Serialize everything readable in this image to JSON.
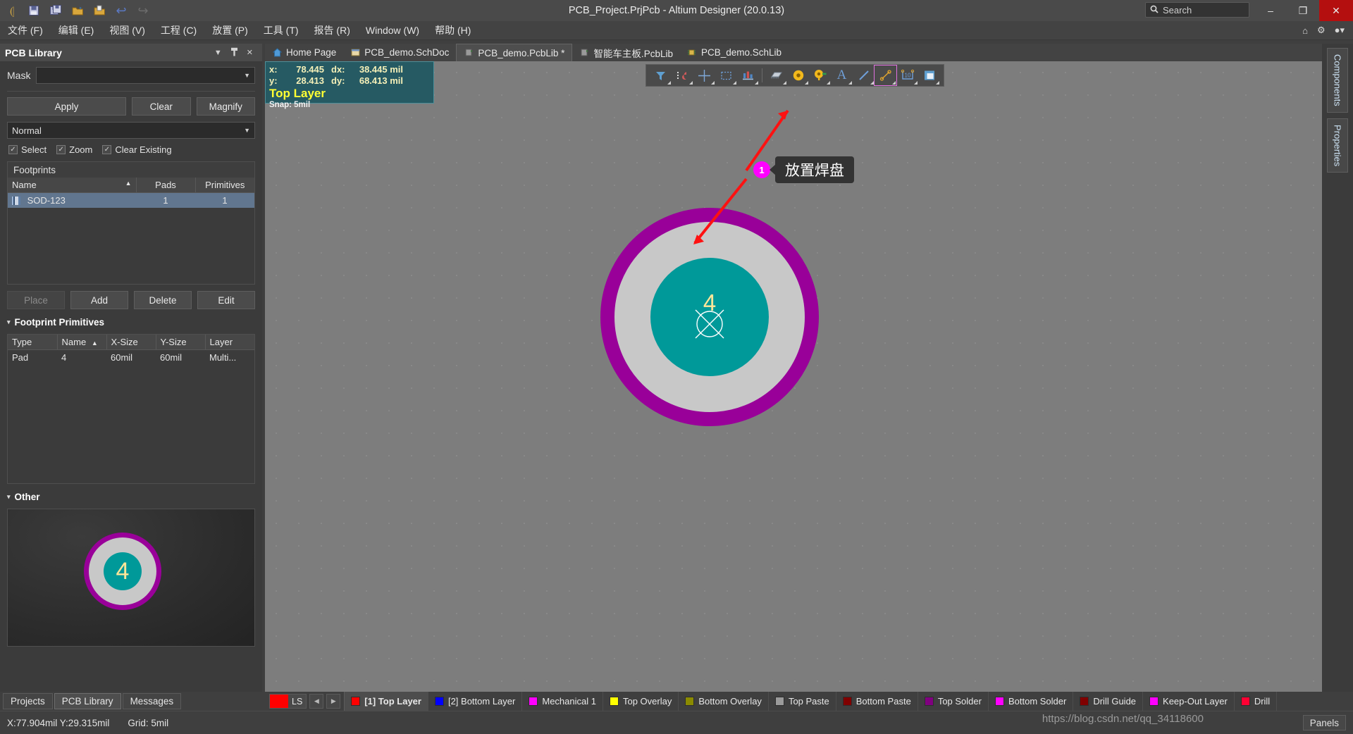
{
  "titlebar": {
    "title": "PCB_Project.PrjPcb - Altium Designer (20.0.13)",
    "quick_access": [
      {
        "name": "altium-logo-icon",
        "glyph": "⚇"
      },
      {
        "name": "save-icon",
        "glyph": "💾"
      },
      {
        "name": "save-all-icon",
        "glyph": "🖫"
      },
      {
        "name": "open-folder-icon",
        "glyph": "📂"
      },
      {
        "name": "open-project-icon",
        "glyph": "🗁"
      },
      {
        "name": "undo-icon",
        "glyph": "↶"
      },
      {
        "name": "redo-icon",
        "glyph": "↷"
      }
    ],
    "search_placeholder": "Search",
    "search_value": "",
    "minimize": "–",
    "maximize": "❐",
    "close": "✕"
  },
  "menubar": {
    "items": [
      "文件 (F)",
      "编辑 (E)",
      "视图 (V)",
      "工程 (C)",
      "放置 (P)",
      "工具 (T)",
      "报告 (R)",
      "Window (W)",
      "帮助 (H)"
    ],
    "right_icons": [
      {
        "name": "home-icon",
        "glyph": "⌂"
      },
      {
        "name": "gear-icon",
        "glyph": "⚙"
      },
      {
        "name": "user-icon",
        "glyph": "●▾"
      }
    ]
  },
  "pcb_library_panel": {
    "title": "PCB Library",
    "header_buttons": [
      {
        "name": "panel-dropdown-icon",
        "glyph": "▼"
      },
      {
        "name": "pin-icon",
        "glyph": "⬇"
      },
      {
        "name": "close-icon",
        "glyph": "✕"
      }
    ],
    "mask_label": "Mask",
    "mask_value": "",
    "buttons": {
      "apply": "Apply",
      "clear": "Clear",
      "magnify": "Magnify"
    },
    "mode_value": "Normal",
    "checkboxes": [
      {
        "label": "Select",
        "checked": true
      },
      {
        "label": "Zoom",
        "checked": true
      },
      {
        "label": "Clear Existing",
        "checked": true
      }
    ],
    "footprints": {
      "caption": "Footprints",
      "columns": [
        "Name",
        "Pads",
        "Primitives"
      ],
      "sort_column": "Name",
      "rows": [
        {
          "name": "SOD-123",
          "pads": "1",
          "primitives": "1",
          "selected": true
        }
      ]
    },
    "footprint_buttons": {
      "place": "Place",
      "place_disabled": true,
      "add": "Add",
      "delete": "Delete",
      "edit": "Edit"
    },
    "primitives": {
      "section_title": "Footprint Primitives",
      "columns": [
        "Type",
        "Name",
        "X-Size",
        "Y-Size",
        "Layer"
      ],
      "sort_column": "Name",
      "rows": [
        {
          "type": "Pad",
          "name": "4",
          "x_size": "60mil",
          "y_size": "60mil",
          "layer": "Multi..."
        }
      ]
    },
    "other": {
      "section_title": "Other",
      "preview_pad_label": "4"
    }
  },
  "doc_tabs": [
    {
      "label": "Home Page",
      "icon": "home-icon",
      "glyph": "🏠",
      "active": false
    },
    {
      "label": "PCB_demo.SchDoc",
      "icon": "schematic-doc-icon",
      "glyph": "▤",
      "active": false
    },
    {
      "label": "PCB_demo.PcbLib *",
      "icon": "pcblib-doc-icon",
      "glyph": "▩",
      "active": true
    },
    {
      "label": "智能车主板.PcbLib",
      "icon": "pcblib-doc-icon",
      "glyph": "▩",
      "active": false
    },
    {
      "label": "PCB_demo.SchLib",
      "icon": "schlib-doc-icon",
      "glyph": "❁",
      "active": false
    }
  ],
  "coord_readout": {
    "x_key": "x:",
    "x_value": "78.445",
    "dx_key": "dx:",
    "dx_value": "38.445 mil",
    "y_key": "y:",
    "y_value": "28.413",
    "dy_key": "dy:",
    "dy_value": "68.413 mil",
    "layer": "Top Layer",
    "snap": "Snap: 5mil"
  },
  "float_toolbar": {
    "tools": [
      {
        "name": "filter-icon",
        "glyph": "▼",
        "selected": false
      },
      {
        "name": "magnet-snap-icon",
        "glyph": "⊂",
        "selected": false
      },
      {
        "name": "crosshair-origin-icon",
        "glyph": "✛",
        "selected": false
      },
      {
        "name": "selection-rect-icon",
        "glyph": "□",
        "selected": false
      },
      {
        "name": "place-component-icon",
        "glyph": "▓",
        "selected": false
      },
      {
        "name": "place-ic-icon",
        "glyph": "▰",
        "selected": false
      },
      {
        "name": "place-pad-icon",
        "glyph": "◎",
        "selected": false
      },
      {
        "name": "place-via-icon",
        "glyph": "⦿",
        "selected": false
      },
      {
        "name": "place-text-icon",
        "glyph": "A",
        "selected": false
      },
      {
        "name": "place-line-icon",
        "glyph": "╱",
        "selected": false
      },
      {
        "name": "place-dimension-icon",
        "glyph": "↗",
        "selected": true
      },
      {
        "name": "place-coordinate-icon",
        "glyph": "10",
        "selected": false
      },
      {
        "name": "place-polygon-icon",
        "glyph": "▣",
        "selected": false
      }
    ]
  },
  "annotation": {
    "badge": "1",
    "text": "放置焊盘"
  },
  "canvas": {
    "pad_number": "4",
    "pad_ring_color": "#990099",
    "pad_fill_color": "#c8c8c8",
    "pad_hole_color": "#009999",
    "pad_text_color": "#ffe699"
  },
  "right_dock": [
    {
      "label": "Components",
      "name": "components-tab"
    },
    {
      "label": "Properties",
      "name": "properties-tab"
    }
  ],
  "panel_tabs": [
    {
      "label": "Projects",
      "active": false
    },
    {
      "label": "PCB Library",
      "active": true
    },
    {
      "label": "Messages",
      "active": false
    }
  ],
  "layer_bar": {
    "ls_chip_label": "LS",
    "ls_chip_color": "#ff0000",
    "nav_prev": "◀",
    "nav_next": "▶",
    "layers": [
      {
        "label": "[1] Top Layer",
        "color": "#ff0000",
        "active": true
      },
      {
        "label": "[2] Bottom Layer",
        "color": "#0000ff",
        "active": false
      },
      {
        "label": "Mechanical 1",
        "color": "#ff00ff",
        "active": false
      },
      {
        "label": "Top Overlay",
        "color": "#ffff00",
        "active": false
      },
      {
        "label": "Bottom Overlay",
        "color": "#8b8b00",
        "active": false
      },
      {
        "label": "Top Paste",
        "color": "#9a9a9a",
        "active": false
      },
      {
        "label": "Bottom Paste",
        "color": "#800000",
        "active": false
      },
      {
        "label": "Top Solder",
        "color": "#800080",
        "active": false
      },
      {
        "label": "Bottom Solder",
        "color": "#ff00ff",
        "active": false
      },
      {
        "label": "Drill Guide",
        "color": "#800000",
        "active": false
      },
      {
        "label": "Keep-Out Layer",
        "color": "#ff00ff",
        "active": false
      },
      {
        "label": "Drill",
        "color": "#ff0033",
        "active": false
      }
    ]
  },
  "statusbar": {
    "coordinates": "X:77.904mil Y:29.315mil",
    "grid": "Grid: 5mil",
    "watermark": "https://blog.csdn.net/qq_34118600",
    "panels_button": "Panels"
  }
}
